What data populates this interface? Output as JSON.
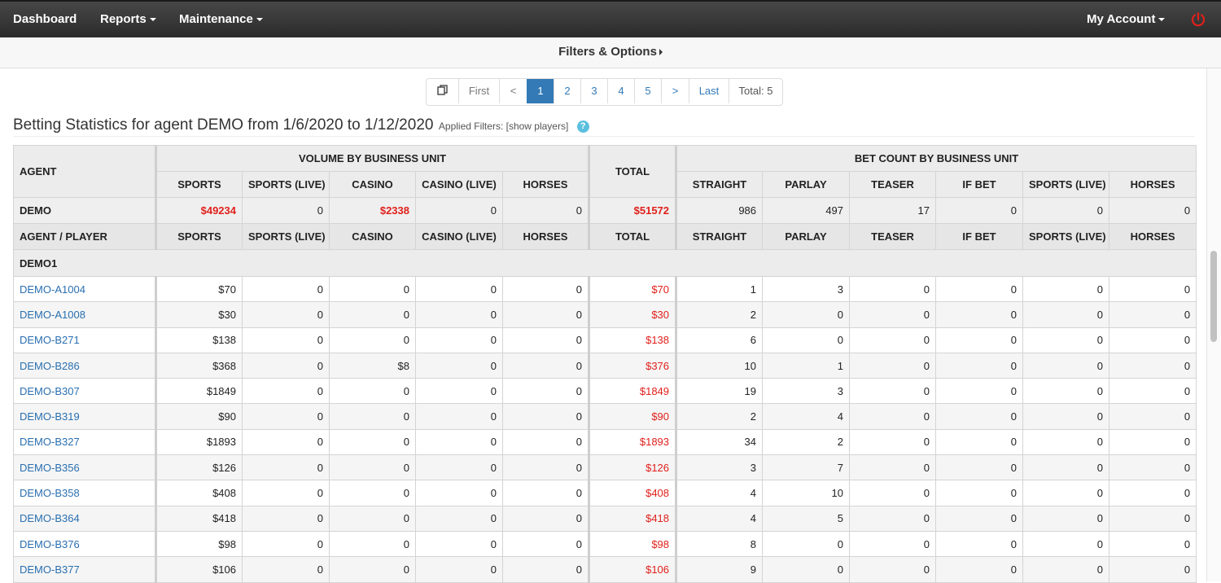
{
  "nav": {
    "dashboard": "Dashboard",
    "reports": "Reports",
    "maintenance": "Maintenance",
    "my_account": "My Account",
    "power_icon": "power-icon"
  },
  "filters_bar": {
    "label": "Filters & Options"
  },
  "pagination": {
    "copy_icon": "copy-icon",
    "first": "First",
    "prev": "<",
    "pages": [
      "1",
      "2",
      "3",
      "4",
      "5"
    ],
    "current": "1",
    "next": ">",
    "last": "Last",
    "total": "Total: 5"
  },
  "heading": {
    "title": "Betting Statistics for agent DEMO from 1/6/2020 to 1/12/2020",
    "filters": "Applied Filters: [show players]",
    "help_icon": "?"
  },
  "table": {
    "agent_header": "AGENT",
    "volume_group": "VOLUME BY BUSINESS UNIT",
    "total_header": "TOTAL",
    "betcount_group": "BET COUNT BY BUSINESS UNIT",
    "volume_cols": [
      "SPORTS",
      "SPORTS (LIVE)",
      "CASINO",
      "CASINO (LIVE)",
      "HORSES"
    ],
    "betcount_cols": [
      "STRAIGHT",
      "PARLAY",
      "TEASER",
      "IF BET",
      "SPORTS (LIVE)",
      "HORSES"
    ],
    "summary": {
      "agent": "DEMO",
      "volume": [
        "$49234",
        "0",
        "$2338",
        "0",
        "0"
      ],
      "total": "$51572",
      "counts": [
        "986",
        "497",
        "17",
        "0",
        "0",
        "0"
      ]
    },
    "player_header": "AGENT / PLAYER",
    "group_label": "DEMO1",
    "rows": [
      {
        "player": "DEMO-A1004",
        "volume": [
          "$70",
          "0",
          "0",
          "0",
          "0"
        ],
        "total": "$70",
        "counts": [
          "1",
          "3",
          "0",
          "0",
          "0",
          "0"
        ]
      },
      {
        "player": "DEMO-A1008",
        "volume": [
          "$30",
          "0",
          "0",
          "0",
          "0"
        ],
        "total": "$30",
        "counts": [
          "2",
          "0",
          "0",
          "0",
          "0",
          "0"
        ]
      },
      {
        "player": "DEMO-B271",
        "volume": [
          "$138",
          "0",
          "0",
          "0",
          "0"
        ],
        "total": "$138",
        "counts": [
          "6",
          "0",
          "0",
          "0",
          "0",
          "0"
        ]
      },
      {
        "player": "DEMO-B286",
        "volume": [
          "$368",
          "0",
          "$8",
          "0",
          "0"
        ],
        "total": "$376",
        "counts": [
          "10",
          "1",
          "0",
          "0",
          "0",
          "0"
        ]
      },
      {
        "player": "DEMO-B307",
        "volume": [
          "$1849",
          "0",
          "0",
          "0",
          "0"
        ],
        "total": "$1849",
        "counts": [
          "19",
          "3",
          "0",
          "0",
          "0",
          "0"
        ]
      },
      {
        "player": "DEMO-B319",
        "volume": [
          "$90",
          "0",
          "0",
          "0",
          "0"
        ],
        "total": "$90",
        "counts": [
          "2",
          "4",
          "0",
          "0",
          "0",
          "0"
        ]
      },
      {
        "player": "DEMO-B327",
        "volume": [
          "$1893",
          "0",
          "0",
          "0",
          "0"
        ],
        "total": "$1893",
        "counts": [
          "34",
          "2",
          "0",
          "0",
          "0",
          "0"
        ]
      },
      {
        "player": "DEMO-B356",
        "volume": [
          "$126",
          "0",
          "0",
          "0",
          "0"
        ],
        "total": "$126",
        "counts": [
          "3",
          "7",
          "0",
          "0",
          "0",
          "0"
        ]
      },
      {
        "player": "DEMO-B358",
        "volume": [
          "$408",
          "0",
          "0",
          "0",
          "0"
        ],
        "total": "$408",
        "counts": [
          "4",
          "10",
          "0",
          "0",
          "0",
          "0"
        ]
      },
      {
        "player": "DEMO-B364",
        "volume": [
          "$418",
          "0",
          "0",
          "0",
          "0"
        ],
        "total": "$418",
        "counts": [
          "4",
          "5",
          "0",
          "0",
          "0",
          "0"
        ]
      },
      {
        "player": "DEMO-B376",
        "volume": [
          "$98",
          "0",
          "0",
          "0",
          "0"
        ],
        "total": "$98",
        "counts": [
          "8",
          "0",
          "0",
          "0",
          "0",
          "0"
        ]
      },
      {
        "player": "DEMO-B377",
        "volume": [
          "$106",
          "0",
          "0",
          "0",
          "0"
        ],
        "total": "$106",
        "counts": [
          "9",
          "0",
          "0",
          "0",
          "0",
          "0"
        ]
      }
    ]
  },
  "colors": {
    "accent": "#337ab7",
    "link": "#2a6fb0",
    "negative_red": "#e0201b",
    "help": "#5bc0de"
  }
}
